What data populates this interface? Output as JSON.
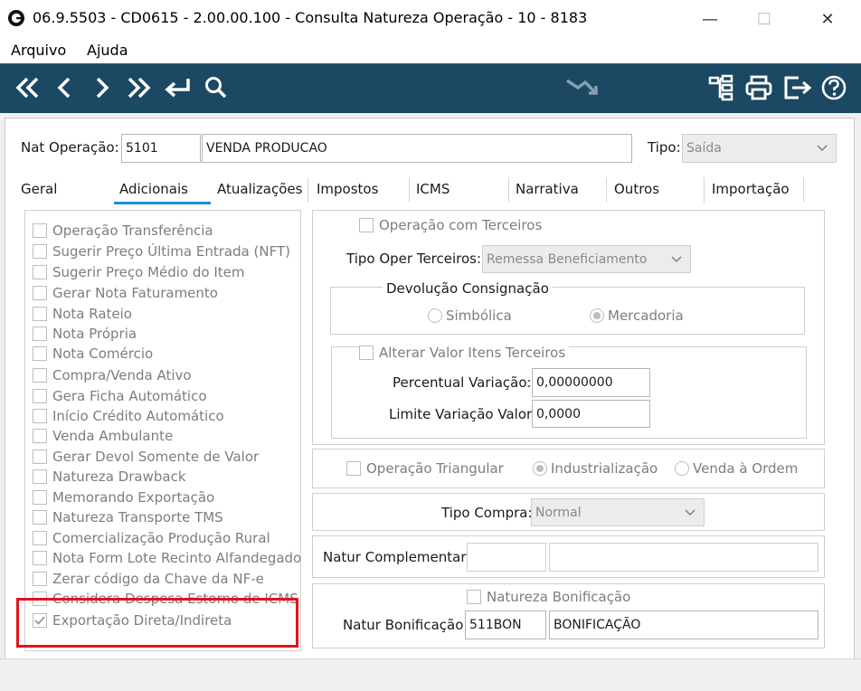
{
  "window": {
    "title": "06.9.5503 - CD0615 - 2.00.00.100 - Consulta Natureza Operação - 10 - 8183",
    "minimize_glyph": "—",
    "maximize_glyph": "☐",
    "close_glyph": "✕"
  },
  "menu": {
    "items": [
      "Arquivo",
      "Ajuda"
    ]
  },
  "toolbar": {
    "icons": [
      "first-record-icon",
      "previous-record-icon",
      "next-record-icon",
      "last-record-icon",
      "return-icon",
      "search-icon",
      "trend-down-icon",
      "tree-structure-icon",
      "print-icon",
      "exit-icon",
      "help-icon"
    ],
    "accent_color": "#1b4862"
  },
  "header": {
    "nat_label": "Nat Operação:",
    "nat_code": "5101",
    "nat_desc": "VENDA PRODUCAO",
    "tipo_label": "Tipo:",
    "tipo_value": "Saída"
  },
  "tabs": [
    "Geral",
    "Adicionais",
    "Atualizações",
    "Impostos",
    "ICMS",
    "Narrativa",
    "Outros",
    "Importação"
  ],
  "active_tab": "Adicionais",
  "left_checks": [
    {
      "label": "Operação Transferência",
      "checked": false
    },
    {
      "label": "Sugerir Preço Última Entrada (NFT)",
      "checked": false
    },
    {
      "label": "Sugerir Preço Médio do Item",
      "checked": false
    },
    {
      "label": "Gerar Nota Faturamento",
      "checked": false
    },
    {
      "label": "Nota Rateio",
      "checked": false
    },
    {
      "label": "Nota Própria",
      "checked": false
    },
    {
      "label": "Nota Comércio",
      "checked": false
    },
    {
      "label": "Compra/Venda Ativo",
      "checked": false
    },
    {
      "label": "Gera Ficha Automático",
      "checked": false
    },
    {
      "label": "Início Crédito Automático",
      "checked": false
    },
    {
      "label": "Venda Ambulante",
      "checked": false
    },
    {
      "label": "Gerar Devol Somente de Valor",
      "checked": false
    },
    {
      "label": "Natureza Drawback",
      "checked": false
    },
    {
      "label": "Memorando Exportação",
      "checked": false
    },
    {
      "label": "Natureza Transporte TMS",
      "checked": false
    },
    {
      "label": "Comercialização Produção Rural",
      "checked": false
    },
    {
      "label": "Nota Form Lote Recinto Alfandegado",
      "checked": false
    },
    {
      "label": "Zerar código da Chave da NF-e",
      "checked": false
    },
    {
      "label": "Considera Despesa Estorno de ICMS",
      "checked": false
    },
    {
      "label": "Exportação Direta/Indireta",
      "checked": true
    }
  ],
  "terceiros": {
    "op_terceiros_label": "Operação com Terceiros",
    "tipo_oper_label": "Tipo Oper Terceiros:",
    "tipo_oper_value": "Remessa Beneficiamento",
    "devolucao_title": "Devolução Consignação",
    "radio_simbolica": "Simbólica",
    "radio_mercadoria": "Mercadoria",
    "alterar_label": "Alterar Valor Itens Terceiros",
    "percentual_label": "Percentual Variação:",
    "percentual_value": "0,00000000",
    "limite_label": "Limite Variação Valor:",
    "limite_value": "0,0000"
  },
  "triangular": {
    "check_label": "Operação Triangular",
    "radio_industrializacao": "Industrialização",
    "radio_venda_ordem": "Venda à Ordem"
  },
  "compra": {
    "label": "Tipo Compra:",
    "value": "Normal"
  },
  "complementar": {
    "label": "Natur Complementar:",
    "code": "",
    "desc": ""
  },
  "bonificacao": {
    "check_label": "Natureza Bonificação",
    "label": "Natur Bonificação:",
    "code": "511BON",
    "desc": "BONIFICAÇÃO"
  },
  "colors": {
    "highlight": "#e0141e",
    "tab_underline": "#1a8fd6"
  }
}
